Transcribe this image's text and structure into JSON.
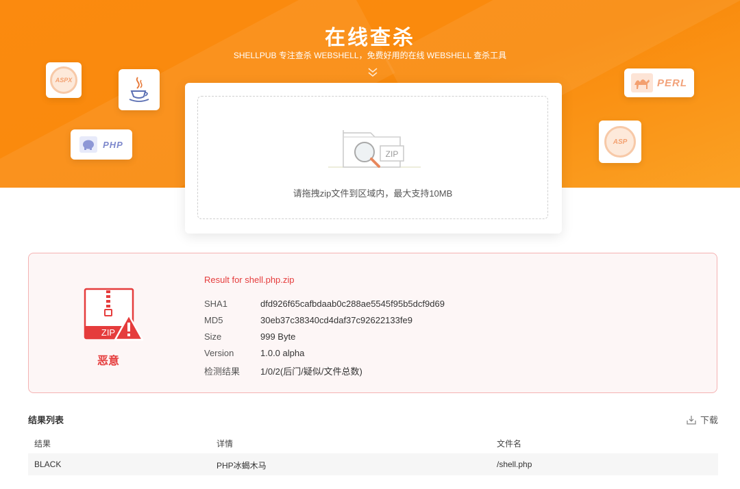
{
  "header": {
    "title": "在线查杀",
    "subtitle": "SHELLPUB 专注查杀 WEBSHELL，免费好用的在线 WEBSHELL 查杀工具"
  },
  "language_tiles": {
    "aspx": "ASPX",
    "php": "PHP",
    "perl": "PERL",
    "asp": "ASP"
  },
  "upload": {
    "zip_label": "ZIP",
    "hint": "请拖拽zip文件到区域内，最大支持10MB"
  },
  "result": {
    "title": "Result for shell.php.zip",
    "zip_label": "ZIP",
    "verdict": "恶意",
    "fields": [
      {
        "label": "SHA1",
        "value": "dfd926f65cafbdaab0c288ae5545f95b5dcf9d69"
      },
      {
        "label": "MD5",
        "value": "30eb37c38340cd4daf37c92622133fe9"
      },
      {
        "label": "Size",
        "value": "999 Byte"
      },
      {
        "label": "Version",
        "value": "1.0.0 alpha"
      },
      {
        "label": "检测结果",
        "value": "1/0/2(后门/疑似/文件总数)"
      }
    ]
  },
  "results_list": {
    "title": "结果列表",
    "download_label": "下载",
    "columns": [
      "结果",
      "详情",
      "文件名"
    ],
    "rows": [
      {
        "result": "BLACK",
        "detail": "PHP冰蝎木马",
        "filename": "/shell.php"
      }
    ]
  },
  "colors": {
    "brand_orange": "#f98a0c",
    "danger_red": "#e53c3c",
    "result_bg": "#fdf6f6"
  }
}
